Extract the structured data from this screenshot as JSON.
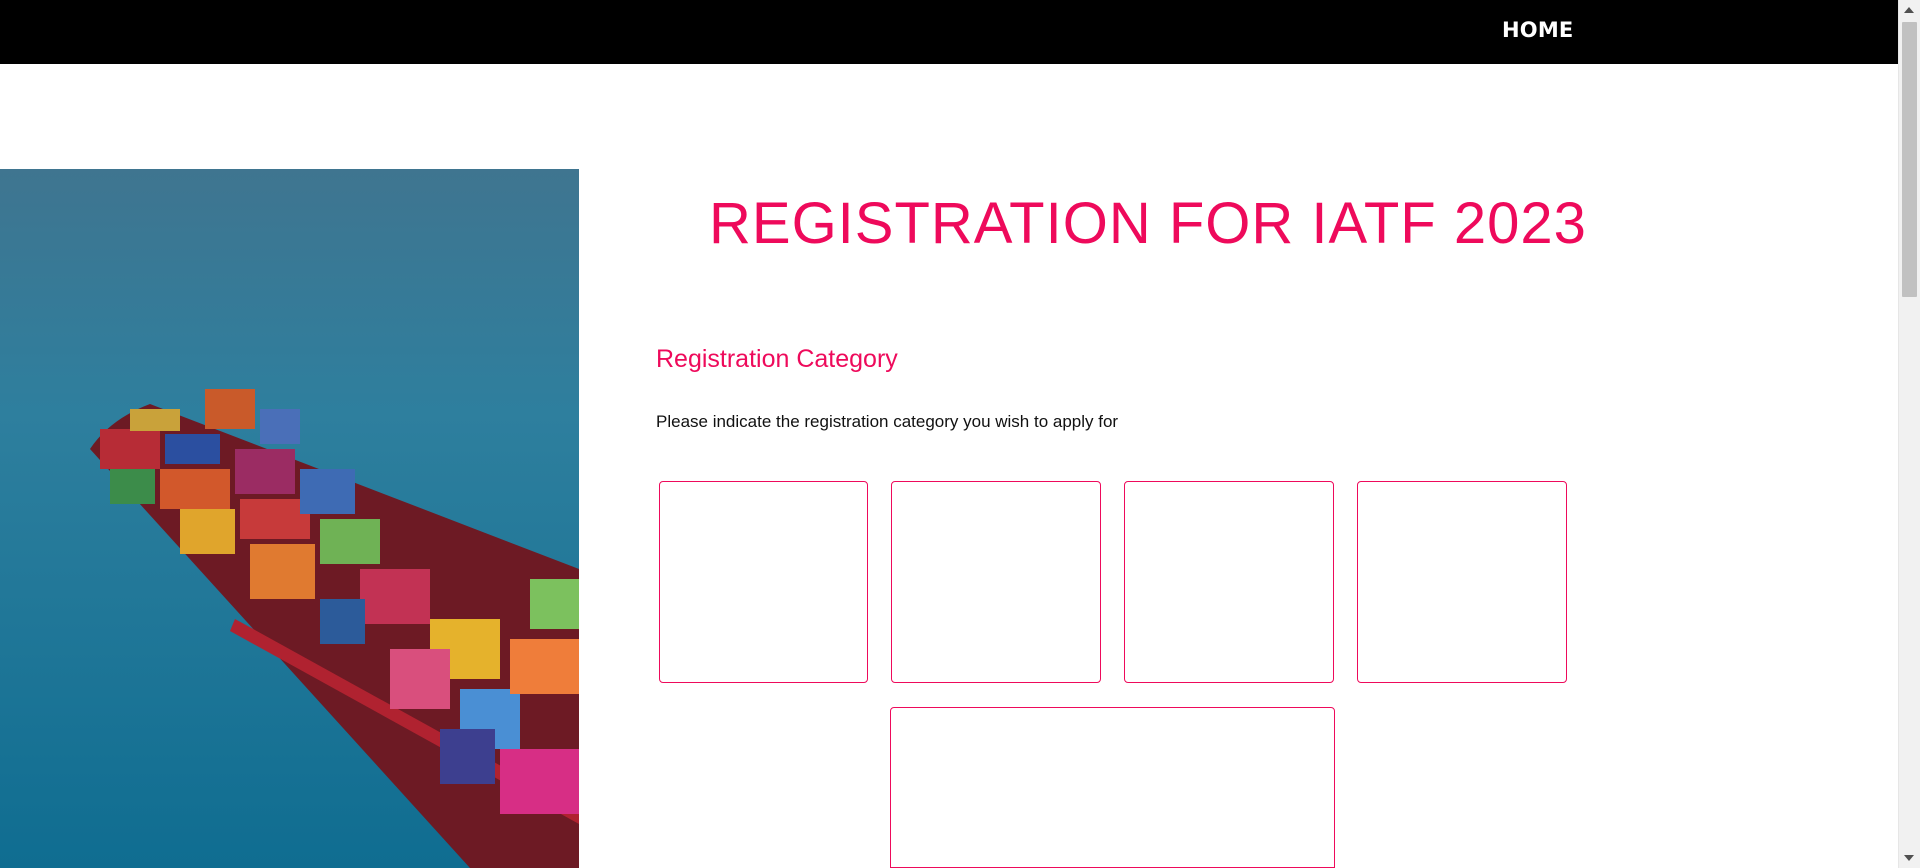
{
  "nav": {
    "home_label": "HOME"
  },
  "hero": {
    "image_alt": "Container ship at sea"
  },
  "main": {
    "title": "REGISTRATION FOR IATF 2023",
    "section_title": "Registration Category",
    "instructions": "Please indicate the registration category you wish to apply for",
    "category_cards": [
      {},
      {},
      {},
      {},
      {}
    ]
  },
  "colors": {
    "accent": "#ee0a5b",
    "nav_background": "#000000",
    "page_background": "#ffffff"
  }
}
